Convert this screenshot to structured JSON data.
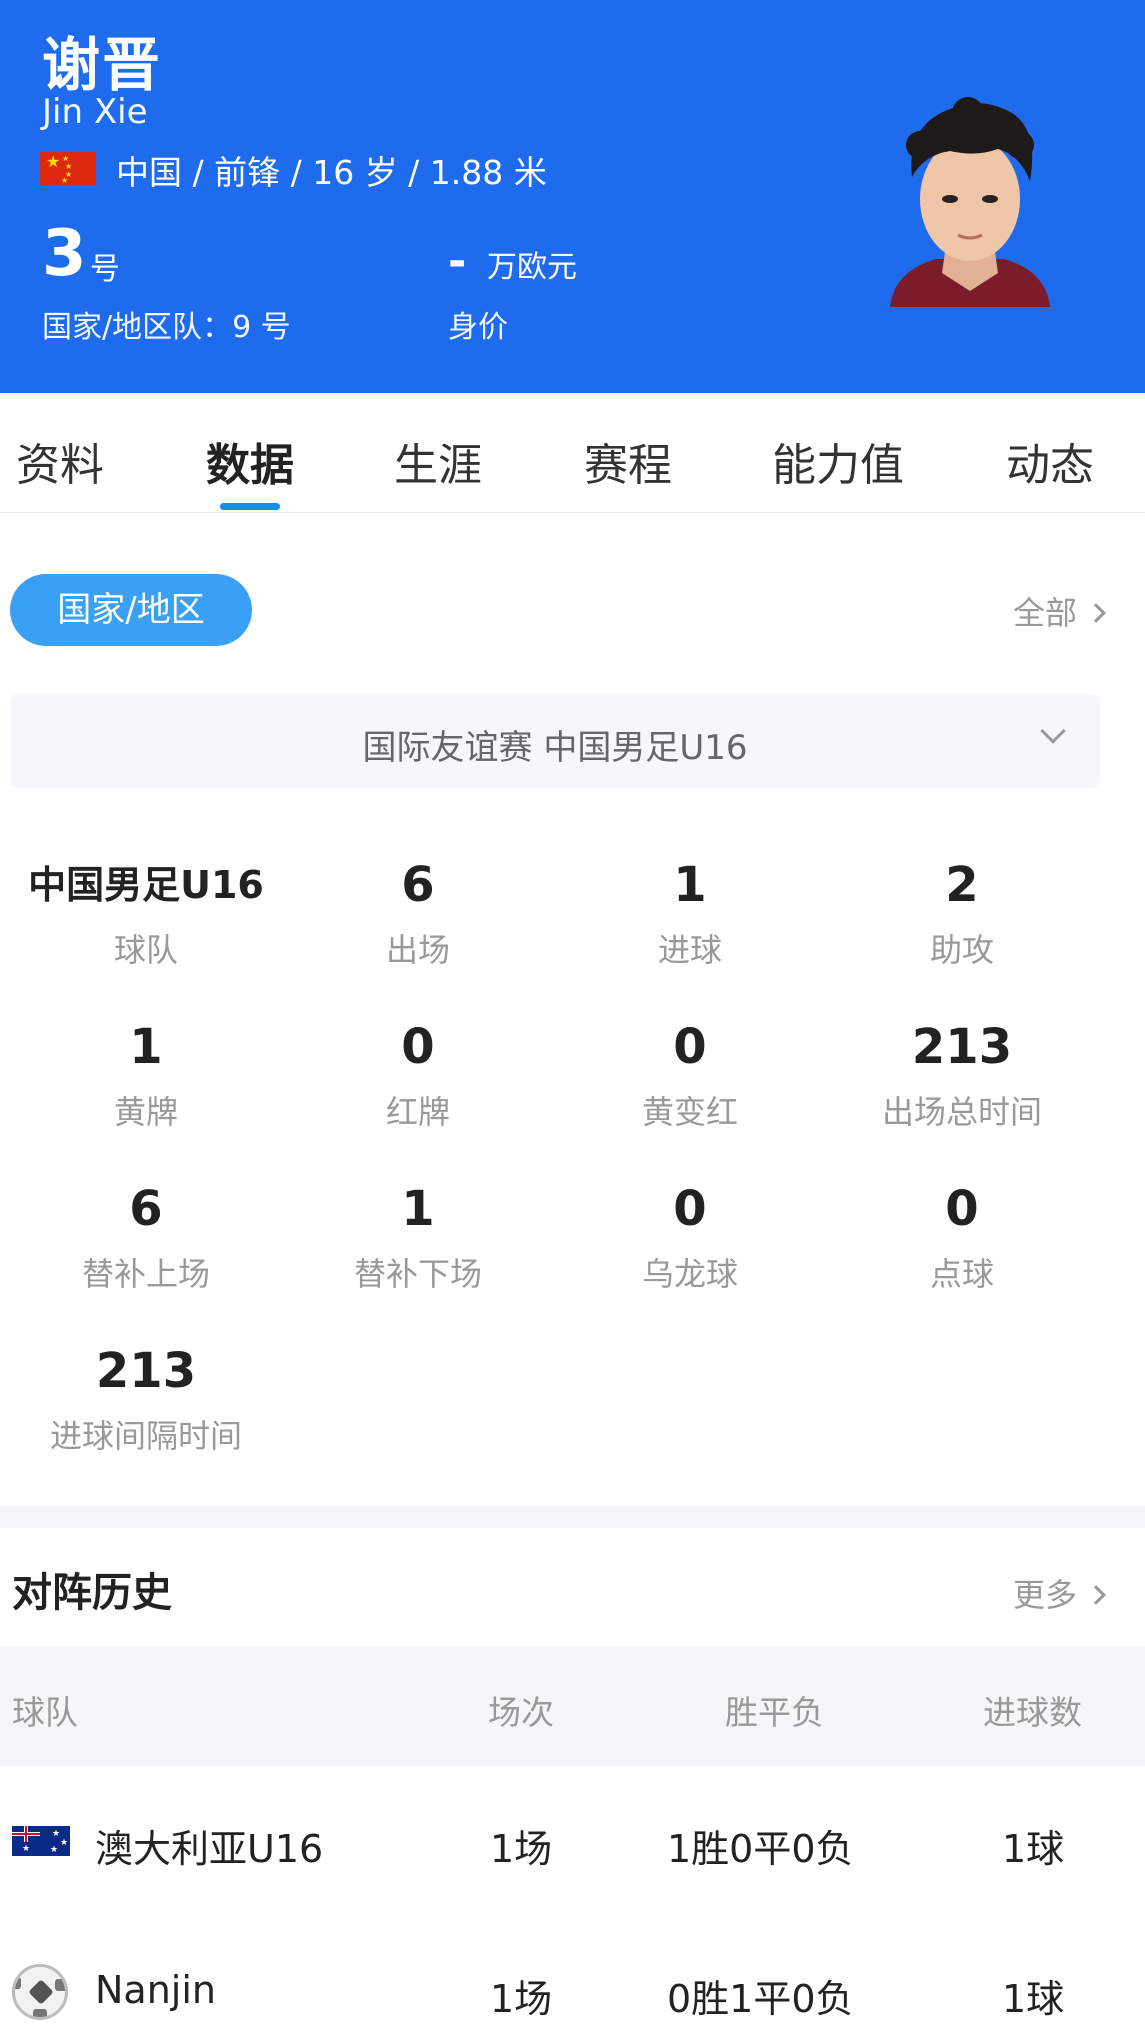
{
  "player": {
    "name_cn": "谢晋",
    "name_en": "Jin Xie",
    "meta": "中国 / 前锋 / 16 岁 / 1.88 米",
    "flag_icon": "china-flag-icon",
    "jersey_number": "3",
    "jersey_unit": "号",
    "national_team": "国家/地区队：9 号",
    "value": "-",
    "value_unit": "万欧元",
    "value_label": "身价"
  },
  "colors": {
    "header_bg": "#1f6bee",
    "accent": "#1a8cf0",
    "pill_bg": "#3aa0f5"
  },
  "tabs": [
    {
      "label": "资料",
      "active": false
    },
    {
      "label": "数据",
      "active": true
    },
    {
      "label": "生涯",
      "active": false
    },
    {
      "label": "赛程",
      "active": false
    },
    {
      "label": "能力值",
      "active": false
    },
    {
      "label": "动态",
      "active": false
    }
  ],
  "filters": {
    "scope_pill": "国家/地区",
    "all_link": "全部",
    "competition": "国际友谊赛 中国男足U16"
  },
  "stats": [
    {
      "value": "中国男足U16",
      "label": "球队"
    },
    {
      "value": "6",
      "label": "出场"
    },
    {
      "value": "1",
      "label": "进球"
    },
    {
      "value": "2",
      "label": "助攻"
    },
    {
      "value": "1",
      "label": "黄牌"
    },
    {
      "value": "0",
      "label": "红牌"
    },
    {
      "value": "0",
      "label": "黄变红"
    },
    {
      "value": "213",
      "label": "出场总时间"
    },
    {
      "value": "6",
      "label": "替补上场"
    },
    {
      "value": "1",
      "label": "替补下场"
    },
    {
      "value": "0",
      "label": "乌龙球"
    },
    {
      "value": "0",
      "label": "点球"
    },
    {
      "value": "213",
      "label": "进球间隔时间"
    }
  ],
  "h2h": {
    "title": "对阵历史",
    "more": "更多",
    "columns": [
      "球队",
      "场次",
      "胜平负",
      "进球数"
    ],
    "rows": [
      {
        "icon": "australia-flag-icon",
        "team": "澳大利亚U16",
        "matches": "1场",
        "record": "1胜0平0负",
        "goals": "1球"
      },
      {
        "icon": "football-icon",
        "team": "Nanjin",
        "matches": "1场",
        "record": "0胜1平0负",
        "goals": "1球"
      }
    ]
  }
}
